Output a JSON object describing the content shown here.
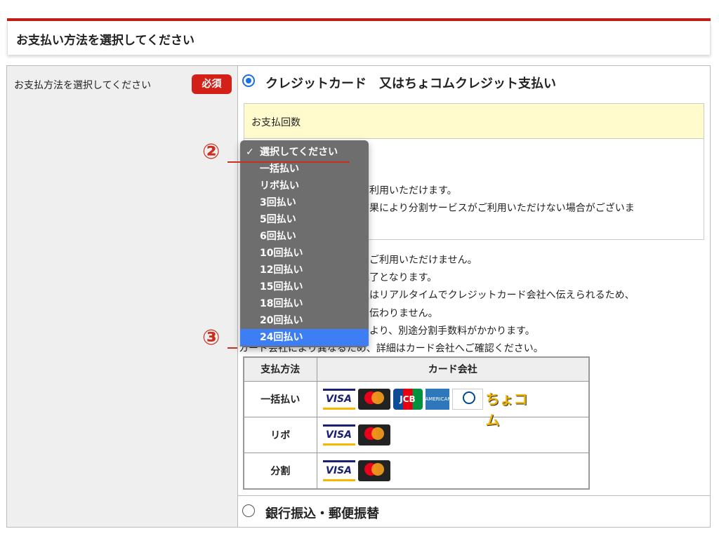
{
  "header": {
    "title": "お支払い方法を選択してください"
  },
  "form": {
    "label": "お支払方法を選択してください",
    "required_badge": "必須"
  },
  "options": {
    "credit": "クレジットカード　又はちょコムクレジット支払い",
    "bank": "銀行振込・郵便振替"
  },
  "installments_box": {
    "title": "お支払回数"
  },
  "notes": [
    "ご利用いただけます。",
    "結果により分割サービスがご利用いただけない場合がございま",
    "はご利用いただけません。",
    "完了となります。",
    "報はリアルタイムでクレジットカード会社へ伝えられるため、",
    "は伝わりません。",
    "により、別途分割手数料がかかります。",
    "カード会社により異なるため、詳細はカード会社へご確認ください。"
  ],
  "card_table": {
    "header_method": "支払方法",
    "header_company": "カード会社",
    "rows": [
      {
        "method": "一括払い",
        "logos": [
          "visa",
          "mastercard",
          "jcb",
          "amex",
          "diners",
          "chocom"
        ]
      },
      {
        "method": "リボ",
        "logos": [
          "visa",
          "mastercard"
        ]
      },
      {
        "method": "分割",
        "logos": [
          "visa",
          "mastercard"
        ]
      }
    ],
    "logo_text": {
      "visa": "VISA",
      "jcb": "JCB",
      "amex": "AMERICAN EXPRESS",
      "chocom": "ちょコム"
    }
  },
  "dropdown": {
    "selected_index": 12,
    "checked_index": 0,
    "options": [
      "選択してください",
      "一括払い",
      "リボ払い",
      "3回払い",
      "5回払い",
      "6回払い",
      "10回払い",
      "12回払い",
      "15回払い",
      "18回払い",
      "20回払い",
      "24回払い"
    ]
  },
  "callouts": {
    "two": "②",
    "three": "③"
  },
  "colors": {
    "accent_red": "#c41c17",
    "radio_blue": "#1a6fe8",
    "highlight_blue": "#3d7ef5",
    "box_yellow": "#fffbcc"
  }
}
